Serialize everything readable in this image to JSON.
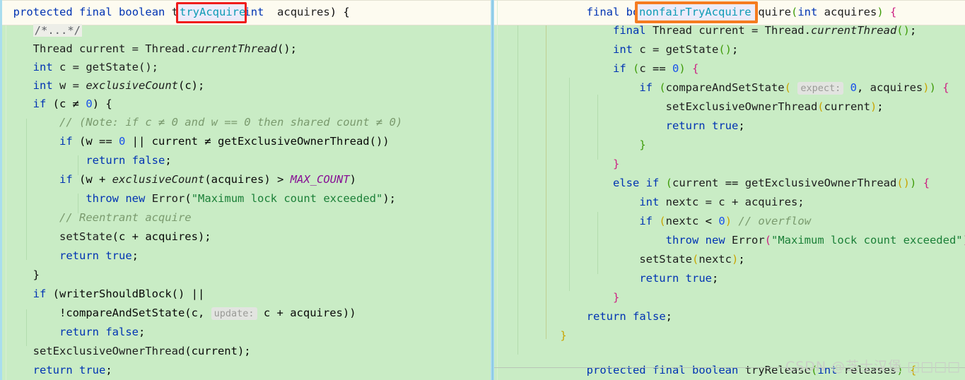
{
  "editor": {
    "background_color": "#c9ecc5",
    "current_line_color": "#fdfbf0",
    "divider_color": "#96cfe8"
  },
  "watermark": {
    "text": "CSDN @芝士汉堡 □□□□"
  },
  "left_pane": {
    "name": "tryAcquire-pane",
    "highlight_box": {
      "label": "tryAcquire",
      "border_color": "#f01c1c",
      "fill_color": "#ecebfa",
      "text_color": "#0d9bb5"
    },
    "lines": [
      "protected final boolean tryAcquire(int acquires) {",
      "    /*...*/",
      "    Thread current = Thread.currentThread();",
      "    int c = getState();",
      "    int w = exclusiveCount(c);",
      "    if (c != 0) {",
      "        // (Note: if c != 0 and w == 0 then shared count != 0)",
      "        if (w == 0 || current != getExclusiveOwnerThread())",
      "            return false;",
      "        if (w + exclusiveCount(acquires) > MAX_COUNT)",
      "            throw new Error(\"Maximum lock count exceeded\");",
      "        // Reentrant acquire",
      "        setState(c + acquires);",
      "        return true;",
      "    }",
      "    if (writerShouldBlock() ||",
      "        !compareAndSetState(c, update: c + acquires))",
      "        return false;",
      "    setExclusiveOwnerThread(current);",
      "    return true;"
    ],
    "inlay_hints": [
      "update:"
    ]
  },
  "right_pane": {
    "name": "nonfairTryAcquire-pane",
    "highlight_box": {
      "label": "nonfairTryAcquire",
      "border_color": "#f57c20",
      "fill_color": "#ecebfa",
      "text_color": "#0d9bb5"
    },
    "lines": [
      "    final boolean nonfairTryAcquire(int acquires) {",
      "        final Thread current = Thread.currentThread();",
      "        int c = getState();",
      "        if (c == 0) {",
      "            if (compareAndSetState( expect: 0, acquires)) {",
      "                setExclusiveOwnerThread(current);",
      "                return true;",
      "            }",
      "        }",
      "        else if (current == getExclusiveOwnerThread()) {",
      "            int nextc = c + acquires;",
      "            if (nextc < 0) // overflow",
      "                throw new Error(\"Maximum lock count exceeded\");",
      "            setState(nextc);",
      "            return true;",
      "        }",
      "        return false;",
      "    }",
      "",
      "    protected final boolean tryRelease(int releases) {"
    ],
    "inlay_hints": [
      "expect:"
    ]
  }
}
